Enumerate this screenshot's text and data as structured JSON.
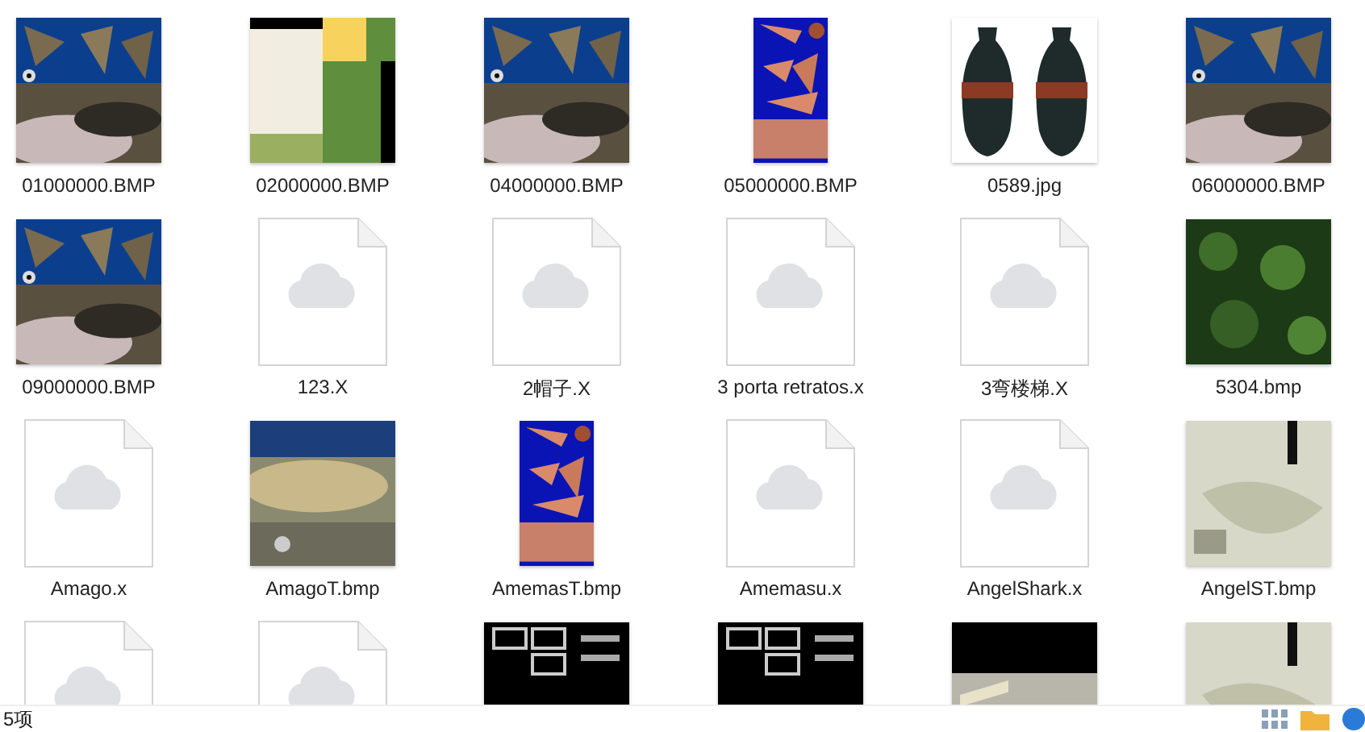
{
  "items": [
    {
      "name": "01000000.BMP",
      "kind": "picture"
    },
    {
      "name": "02000000.BMP",
      "kind": "picture"
    },
    {
      "name": "04000000.BMP",
      "kind": "picture"
    },
    {
      "name": "05000000.BMP",
      "kind": "portrait"
    },
    {
      "name": "0589.jpg",
      "kind": "picture"
    },
    {
      "name": "06000000.BMP",
      "kind": "picture"
    },
    {
      "name": "09000000.BMP",
      "kind": "picture"
    },
    {
      "name": "123.X",
      "kind": "file"
    },
    {
      "name": "2帽子.X",
      "kind": "file"
    },
    {
      "name": "3 porta retratos.x",
      "kind": "file"
    },
    {
      "name": "3弯楼梯.X",
      "kind": "file"
    },
    {
      "name": "5304.bmp",
      "kind": "picture"
    },
    {
      "name": "Amago.x",
      "kind": "file"
    },
    {
      "name": "AmagoT.bmp",
      "kind": "picture"
    },
    {
      "name": "AmemasT.bmp",
      "kind": "portrait"
    },
    {
      "name": "Amemasu.x",
      "kind": "file"
    },
    {
      "name": "AngelShark.x",
      "kind": "file"
    },
    {
      "name": "AngelST.bmp",
      "kind": "picture"
    },
    {
      "kind": "file"
    },
    {
      "kind": "file"
    },
    {
      "kind": "picture"
    },
    {
      "kind": "picture"
    },
    {
      "kind": "picture"
    },
    {
      "kind": "picture"
    }
  ],
  "status_bar": {
    "count": "5项"
  }
}
